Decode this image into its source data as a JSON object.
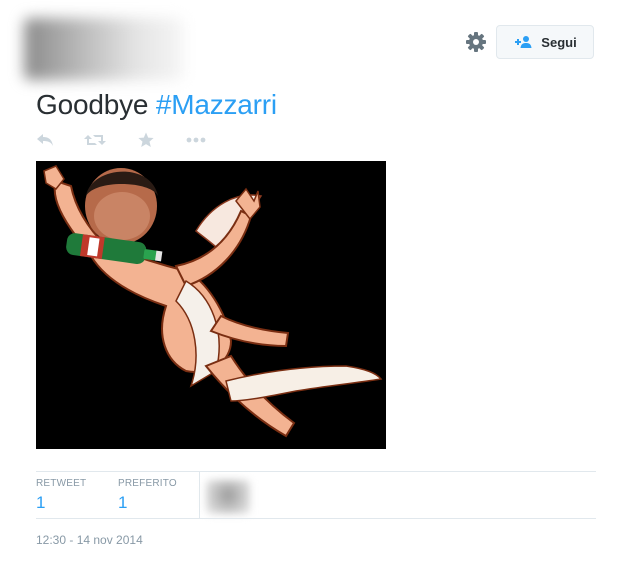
{
  "header": {
    "follow_label": "Segui",
    "gear_icon": "gear-icon",
    "follow_icon": "add-user-icon"
  },
  "tweet": {
    "text_plain": "Goodbye ",
    "hashtag": "#Mazzarri",
    "actions": [
      "reply-icon",
      "retweet-icon",
      "favorite-icon",
      "more-icon"
    ]
  },
  "stats": {
    "retweet_label": "RETWEET",
    "retweet_count": "1",
    "favorite_label": "PREFERITO",
    "favorite_count": "1"
  },
  "timestamp": "12:30 - 14 nov 2014",
  "colors": {
    "hashtag": "#2b9ff4",
    "text": "#292f33",
    "muted": "#8899a6",
    "border": "#e1e8ed"
  }
}
